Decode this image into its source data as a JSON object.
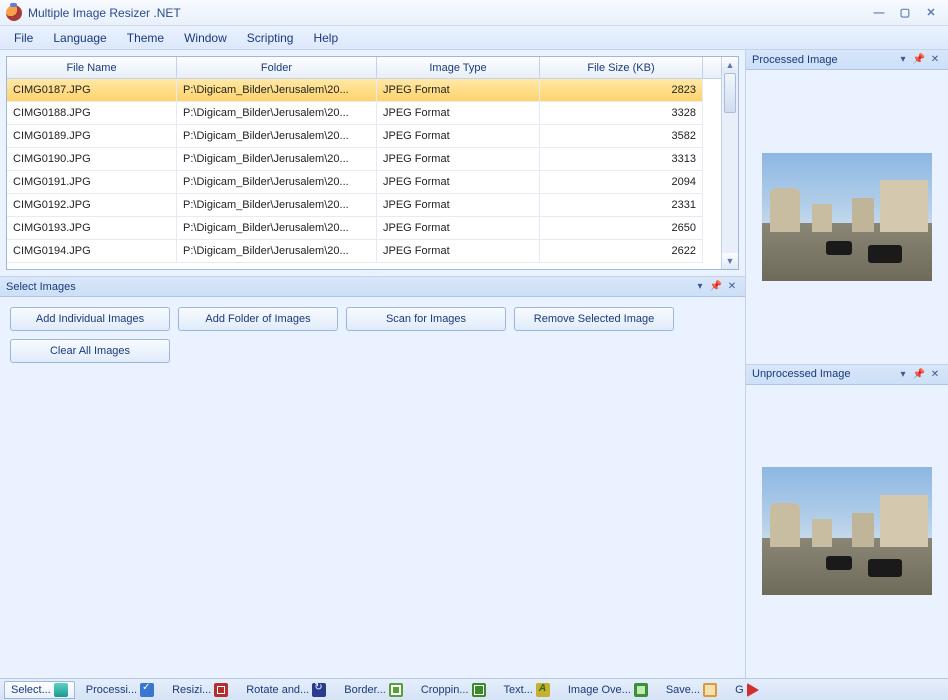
{
  "titlebar": {
    "title": "Multiple Image Resizer .NET"
  },
  "menu": {
    "items": [
      "File",
      "Language",
      "Theme",
      "Window",
      "Scripting",
      "Help"
    ]
  },
  "table": {
    "headers": {
      "name": "File Name",
      "folder": "Folder",
      "type": "Image Type",
      "size": "File Size (KB)"
    },
    "rows": [
      {
        "name": "CIMG0187.JPG",
        "folder": "P:\\Digicam_Bilder\\Jerusalem\\20...",
        "type": "JPEG Format",
        "size": "2823"
      },
      {
        "name": "CIMG0188.JPG",
        "folder": "P:\\Digicam_Bilder\\Jerusalem\\20...",
        "type": "JPEG Format",
        "size": "3328"
      },
      {
        "name": "CIMG0189.JPG",
        "folder": "P:\\Digicam_Bilder\\Jerusalem\\20...",
        "type": "JPEG Format",
        "size": "3582"
      },
      {
        "name": "CIMG0190.JPG",
        "folder": "P:\\Digicam_Bilder\\Jerusalem\\20...",
        "type": "JPEG Format",
        "size": "3313"
      },
      {
        "name": "CIMG0191.JPG",
        "folder": "P:\\Digicam_Bilder\\Jerusalem\\20...",
        "type": "JPEG Format",
        "size": "2094"
      },
      {
        "name": "CIMG0192.JPG",
        "folder": "P:\\Digicam_Bilder\\Jerusalem\\20...",
        "type": "JPEG Format",
        "size": "2331"
      },
      {
        "name": "CIMG0193.JPG",
        "folder": "P:\\Digicam_Bilder\\Jerusalem\\20...",
        "type": "JPEG Format",
        "size": "2650"
      },
      {
        "name": "CIMG0194.JPG",
        "folder": "P:\\Digicam_Bilder\\Jerusalem\\20...",
        "type": "JPEG Format",
        "size": "2622"
      }
    ]
  },
  "select_panel": {
    "title": "Select Images",
    "buttons": {
      "add_individual": "Add Individual Images",
      "add_folder": "Add Folder of Images",
      "scan": "Scan for Images",
      "remove": "Remove Selected Image",
      "clear": "Clear All Images"
    }
  },
  "right": {
    "processed_title": "Processed Image",
    "unprocessed_title": "Unprocessed Image"
  },
  "tabs": {
    "select": "Select...",
    "processing": "Processi...",
    "resizing": "Resizi...",
    "rotate": "Rotate and...",
    "border": "Border...",
    "cropping": "Croppin...",
    "text": "Text...",
    "overlay": "Image Ove...",
    "save": "Save...",
    "go": "G"
  }
}
